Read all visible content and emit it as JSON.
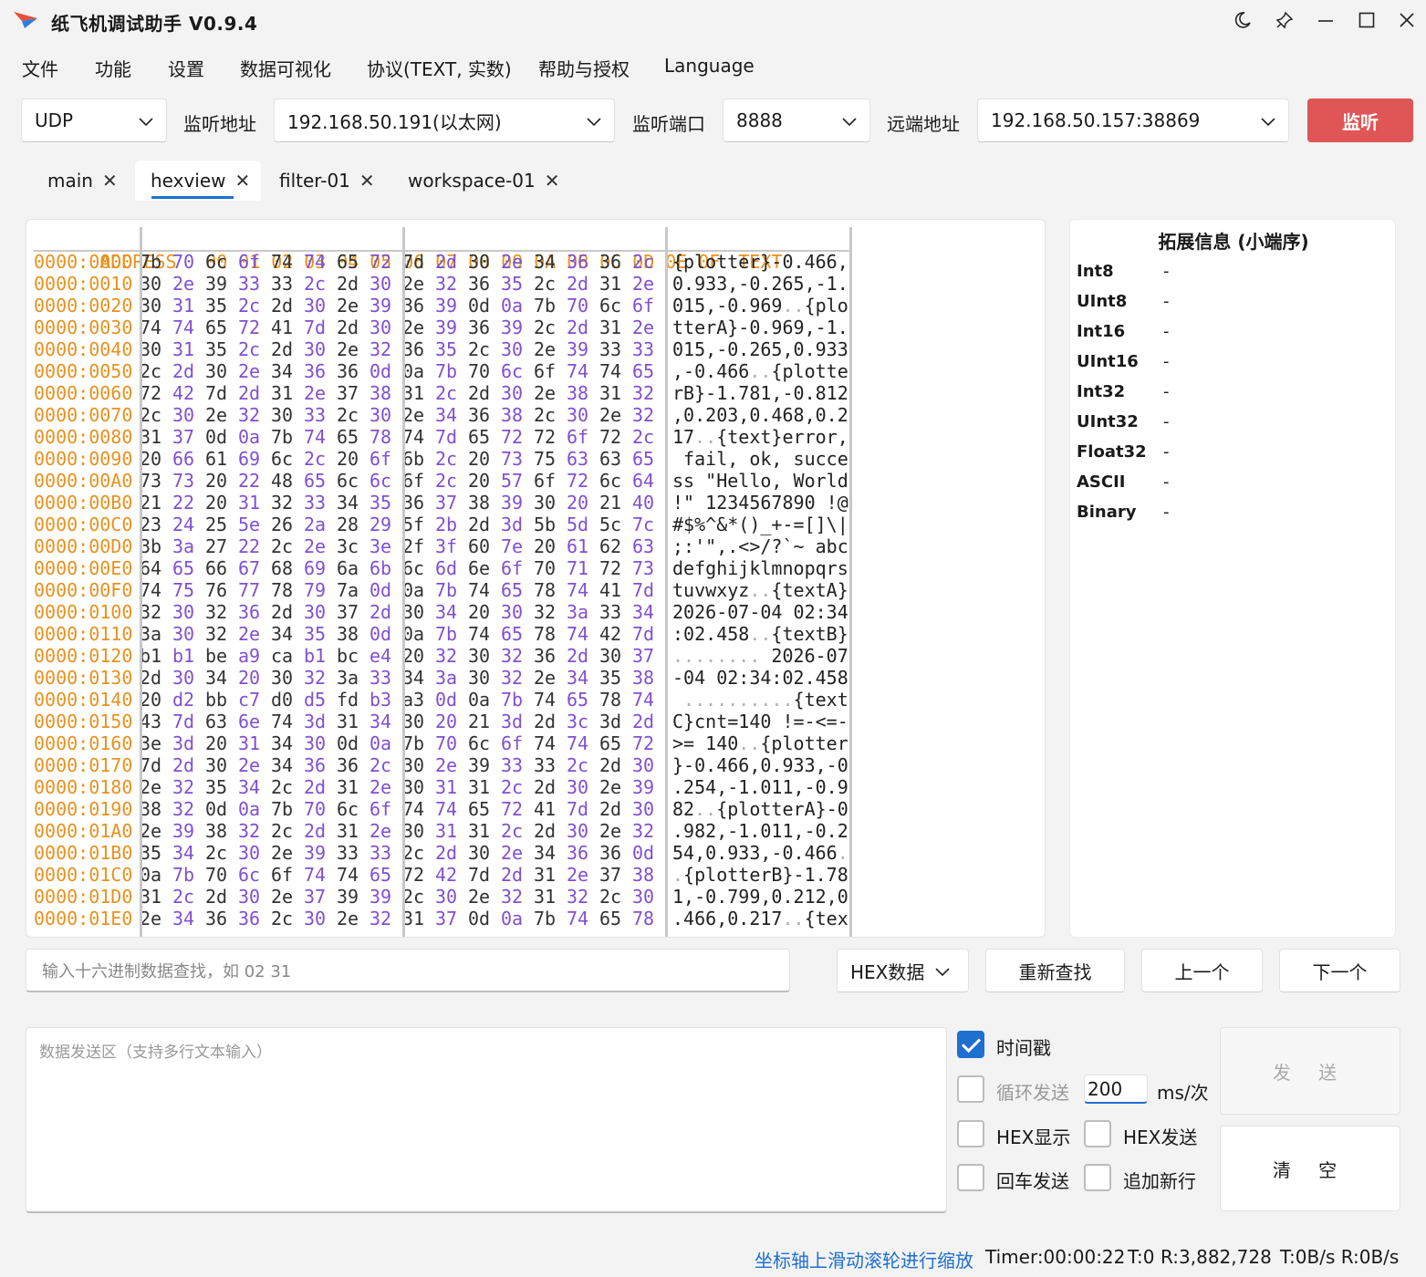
{
  "window": {
    "title": "纸飞机调试助手 V0.9.4"
  },
  "menu": [
    "文件",
    "功能",
    "设置",
    "数据可视化",
    "协议(TEXT, 实数)",
    "帮助与授权",
    "Language"
  ],
  "conn": {
    "protocol": "UDP",
    "listen_addr_label": "监听地址",
    "listen_addr": "192.168.50.191(以太网)",
    "listen_port_label": "监听端口",
    "listen_port": "8888",
    "remote_addr_label": "远端地址",
    "remote_addr": "192.168.50.157:38869",
    "listen_button": "监听"
  },
  "tabs": [
    {
      "label": "main",
      "active": false
    },
    {
      "label": "hexview",
      "active": true
    },
    {
      "label": "filter-01",
      "active": false
    },
    {
      "label": "workspace-01",
      "active": false
    }
  ],
  "hex": {
    "address_header": "ADDRESS",
    "columns": [
      "00",
      "01",
      "02",
      "03",
      "04",
      "05",
      "06",
      "07",
      "08",
      "09",
      "0A",
      "0B",
      "0C",
      "0D",
      "0E",
      "0F"
    ],
    "text_header": "TEXT",
    "rows": [
      {
        "addr": "0000:0000",
        "bytes": [
          "7b",
          "70",
          "6c",
          "6f",
          "74",
          "74",
          "65",
          "72",
          "7d",
          "2d",
          "30",
          "2e",
          "34",
          "36",
          "36",
          "2c"
        ],
        "text": "{plotter}-0.466,"
      },
      {
        "addr": "0000:0010",
        "bytes": [
          "30",
          "2e",
          "39",
          "33",
          "33",
          "2c",
          "2d",
          "30",
          "2e",
          "32",
          "36",
          "35",
          "2c",
          "2d",
          "31",
          "2e"
        ],
        "text": "0.933,-0.265,-1."
      },
      {
        "addr": "0000:0020",
        "bytes": [
          "30",
          "31",
          "35",
          "2c",
          "2d",
          "30",
          "2e",
          "39",
          "36",
          "39",
          "0d",
          "0a",
          "7b",
          "70",
          "6c",
          "6f"
        ],
        "text": "015,-0.969..{plo"
      },
      {
        "addr": "0000:0030",
        "bytes": [
          "74",
          "74",
          "65",
          "72",
          "41",
          "7d",
          "2d",
          "30",
          "2e",
          "39",
          "36",
          "39",
          "2c",
          "2d",
          "31",
          "2e"
        ],
        "text": "tterA}-0.969,-1."
      },
      {
        "addr": "0000:0040",
        "bytes": [
          "30",
          "31",
          "35",
          "2c",
          "2d",
          "30",
          "2e",
          "32",
          "36",
          "35",
          "2c",
          "30",
          "2e",
          "39",
          "33",
          "33"
        ],
        "text": "015,-0.265,0.933"
      },
      {
        "addr": "0000:0050",
        "bytes": [
          "2c",
          "2d",
          "30",
          "2e",
          "34",
          "36",
          "36",
          "0d",
          "0a",
          "7b",
          "70",
          "6c",
          "6f",
          "74",
          "74",
          "65"
        ],
        "text": ",-0.466..{plotte"
      },
      {
        "addr": "0000:0060",
        "bytes": [
          "72",
          "42",
          "7d",
          "2d",
          "31",
          "2e",
          "37",
          "38",
          "31",
          "2c",
          "2d",
          "30",
          "2e",
          "38",
          "31",
          "32"
        ],
        "text": "rB}-1.781,-0.812"
      },
      {
        "addr": "0000:0070",
        "bytes": [
          "2c",
          "30",
          "2e",
          "32",
          "30",
          "33",
          "2c",
          "30",
          "2e",
          "34",
          "36",
          "38",
          "2c",
          "30",
          "2e",
          "32"
        ],
        "text": ",0.203,0.468,0.2"
      },
      {
        "addr": "0000:0080",
        "bytes": [
          "31",
          "37",
          "0d",
          "0a",
          "7b",
          "74",
          "65",
          "78",
          "74",
          "7d",
          "65",
          "72",
          "72",
          "6f",
          "72",
          "2c"
        ],
        "text": "17..{text}error,"
      },
      {
        "addr": "0000:0090",
        "bytes": [
          "20",
          "66",
          "61",
          "69",
          "6c",
          "2c",
          "20",
          "6f",
          "6b",
          "2c",
          "20",
          "73",
          "75",
          "63",
          "63",
          "65"
        ],
        "text": " fail, ok, succe"
      },
      {
        "addr": "0000:00A0",
        "bytes": [
          "73",
          "73",
          "20",
          "22",
          "48",
          "65",
          "6c",
          "6c",
          "6f",
          "2c",
          "20",
          "57",
          "6f",
          "72",
          "6c",
          "64"
        ],
        "text": "ss \"Hello, World"
      },
      {
        "addr": "0000:00B0",
        "bytes": [
          "21",
          "22",
          "20",
          "31",
          "32",
          "33",
          "34",
          "35",
          "36",
          "37",
          "38",
          "39",
          "30",
          "20",
          "21",
          "40"
        ],
        "text": "!\" 1234567890 !@"
      },
      {
        "addr": "0000:00C0",
        "bytes": [
          "23",
          "24",
          "25",
          "5e",
          "26",
          "2a",
          "28",
          "29",
          "5f",
          "2b",
          "2d",
          "3d",
          "5b",
          "5d",
          "5c",
          "7c"
        ],
        "text": "#$%^&*()_+-=[]\\|"
      },
      {
        "addr": "0000:00D0",
        "bytes": [
          "3b",
          "3a",
          "27",
          "22",
          "2c",
          "2e",
          "3c",
          "3e",
          "2f",
          "3f",
          "60",
          "7e",
          "20",
          "61",
          "62",
          "63"
        ],
        "text": ";:'\",.<>/?`~ abc"
      },
      {
        "addr": "0000:00E0",
        "bytes": [
          "64",
          "65",
          "66",
          "67",
          "68",
          "69",
          "6a",
          "6b",
          "6c",
          "6d",
          "6e",
          "6f",
          "70",
          "71",
          "72",
          "73"
        ],
        "text": "defghijklmnopqrs"
      },
      {
        "addr": "0000:00F0",
        "bytes": [
          "74",
          "75",
          "76",
          "77",
          "78",
          "79",
          "7a",
          "0d",
          "0a",
          "7b",
          "74",
          "65",
          "78",
          "74",
          "41",
          "7d"
        ],
        "text": "tuvwxyz..{textA}"
      },
      {
        "addr": "0000:0100",
        "bytes": [
          "32",
          "30",
          "32",
          "36",
          "2d",
          "30",
          "37",
          "2d",
          "30",
          "34",
          "20",
          "30",
          "32",
          "3a",
          "33",
          "34"
        ],
        "text": "2026-07-04 02:34"
      },
      {
        "addr": "0000:0110",
        "bytes": [
          "3a",
          "30",
          "32",
          "2e",
          "34",
          "35",
          "38",
          "0d",
          "0a",
          "7b",
          "74",
          "65",
          "78",
          "74",
          "42",
          "7d"
        ],
        "text": ":02.458..{textB}"
      },
      {
        "addr": "0000:0120",
        "bytes": [
          "b1",
          "b1",
          "be",
          "a9",
          "ca",
          "b1",
          "bc",
          "e4",
          "20",
          "32",
          "30",
          "32",
          "36",
          "2d",
          "30",
          "37"
        ],
        "text": "........ 2026-07"
      },
      {
        "addr": "0000:0130",
        "bytes": [
          "2d",
          "30",
          "34",
          "20",
          "30",
          "32",
          "3a",
          "33",
          "34",
          "3a",
          "30",
          "32",
          "2e",
          "34",
          "35",
          "38"
        ],
        "text": "-04 02:34:02.458"
      },
      {
        "addr": "0000:0140",
        "bytes": [
          "20",
          "d2",
          "bb",
          "c7",
          "d0",
          "d5",
          "fd",
          "b3",
          "a3",
          "0d",
          "0a",
          "7b",
          "74",
          "65",
          "78",
          "74"
        ],
        "text": " ..........{text"
      },
      {
        "addr": "0000:0150",
        "bytes": [
          "43",
          "7d",
          "63",
          "6e",
          "74",
          "3d",
          "31",
          "34",
          "30",
          "20",
          "21",
          "3d",
          "2d",
          "3c",
          "3d",
          "2d"
        ],
        "text": "C}cnt=140 !=-<=-"
      },
      {
        "addr": "0000:0160",
        "bytes": [
          "3e",
          "3d",
          "20",
          "31",
          "34",
          "30",
          "0d",
          "0a",
          "7b",
          "70",
          "6c",
          "6f",
          "74",
          "74",
          "65",
          "72"
        ],
        "text": ">= 140..{plotter"
      },
      {
        "addr": "0000:0170",
        "bytes": [
          "7d",
          "2d",
          "30",
          "2e",
          "34",
          "36",
          "36",
          "2c",
          "30",
          "2e",
          "39",
          "33",
          "33",
          "2c",
          "2d",
          "30"
        ],
        "text": "}-0.466,0.933,-0"
      },
      {
        "addr": "0000:0180",
        "bytes": [
          "2e",
          "32",
          "35",
          "34",
          "2c",
          "2d",
          "31",
          "2e",
          "30",
          "31",
          "31",
          "2c",
          "2d",
          "30",
          "2e",
          "39"
        ],
        "text": ".254,-1.011,-0.9"
      },
      {
        "addr": "0000:0190",
        "bytes": [
          "38",
          "32",
          "0d",
          "0a",
          "7b",
          "70",
          "6c",
          "6f",
          "74",
          "74",
          "65",
          "72",
          "41",
          "7d",
          "2d",
          "30"
        ],
        "text": "82..{plotterA}-0"
      },
      {
        "addr": "0000:01A0",
        "bytes": [
          "2e",
          "39",
          "38",
          "32",
          "2c",
          "2d",
          "31",
          "2e",
          "30",
          "31",
          "31",
          "2c",
          "2d",
          "30",
          "2e",
          "32"
        ],
        "text": ".982,-1.011,-0.2"
      },
      {
        "addr": "0000:01B0",
        "bytes": [
          "35",
          "34",
          "2c",
          "30",
          "2e",
          "39",
          "33",
          "33",
          "2c",
          "2d",
          "30",
          "2e",
          "34",
          "36",
          "36",
          "0d"
        ],
        "text": "54,0.933,-0.466."
      },
      {
        "addr": "0000:01C0",
        "bytes": [
          "0a",
          "7b",
          "70",
          "6c",
          "6f",
          "74",
          "74",
          "65",
          "72",
          "42",
          "7d",
          "2d",
          "31",
          "2e",
          "37",
          "38"
        ],
        "text": ".{plotterB}-1.78"
      },
      {
        "addr": "0000:01D0",
        "bytes": [
          "31",
          "2c",
          "2d",
          "30",
          "2e",
          "37",
          "39",
          "39",
          "2c",
          "30",
          "2e",
          "32",
          "31",
          "32",
          "2c",
          "30"
        ],
        "text": "1,-0.799,0.212,0"
      },
      {
        "addr": "0000:01E0",
        "bytes": [
          "2e",
          "34",
          "36",
          "36",
          "2c",
          "30",
          "2e",
          "32",
          "31",
          "37",
          "0d",
          "0a",
          "7b",
          "74",
          "65",
          "78"
        ],
        "text": ".466,0.217..{tex"
      }
    ]
  },
  "ext": {
    "title": "拓展信息 (小端序)",
    "rows": [
      {
        "label": "Int8",
        "value": "-"
      },
      {
        "label": "UInt8",
        "value": "-"
      },
      {
        "label": "Int16",
        "value": "-"
      },
      {
        "label": "UInt16",
        "value": "-"
      },
      {
        "label": "Int32",
        "value": "-"
      },
      {
        "label": "UInt32",
        "value": "-"
      },
      {
        "label": "Float32",
        "value": "-"
      },
      {
        "label": "ASCII",
        "value": "-"
      },
      {
        "label": "Binary",
        "value": "-"
      }
    ]
  },
  "search": {
    "placeholder": "输入十六进制数据查找，如 02 31",
    "mode": "HEX数据",
    "research": "重新查找",
    "prev": "上一个",
    "next": "下一个"
  },
  "send": {
    "placeholder": "数据发送区（支持多行文本输入）",
    "timestamp": {
      "label": "时间戳",
      "checked": true
    },
    "loop": {
      "label": "循环发送",
      "checked": false
    },
    "interval": "200",
    "interval_unit": "ms/次",
    "hex_display": {
      "label": "HEX显示",
      "checked": false
    },
    "hex_send": {
      "label": "HEX发送",
      "checked": false
    },
    "enter_send": {
      "label": "回车发送",
      "checked": false
    },
    "append_newline": {
      "label": "追加新行",
      "checked": false
    },
    "send_button": "发 送",
    "clear_button": "清 空"
  },
  "status": {
    "hint": "坐标轴上滑动滚轮进行缩放",
    "timer": "Timer:00:00:22",
    "t": "T:0",
    "r": "R:3,882,728",
    "rate": "T:0B/s R:0B/s"
  },
  "colors": {
    "accent": "#1f6fd1",
    "listen": "#e05555",
    "address": "#e8911e",
    "odd_byte": "#8050d0"
  }
}
